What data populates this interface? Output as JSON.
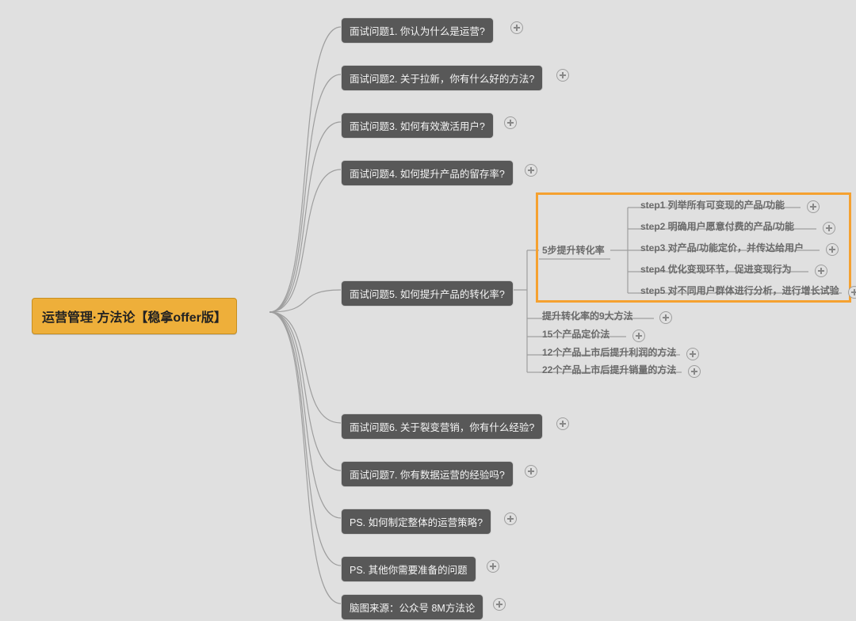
{
  "root": {
    "label": "运营管理·方法论【稳拿offer版】"
  },
  "branches": [
    {
      "id": "b1",
      "label": "面试问题1. 你认为什么是运营?"
    },
    {
      "id": "b2",
      "label": "面试问题2. 关于拉新，你有什么好的方法?"
    },
    {
      "id": "b3",
      "label": "面试问题3. 如何有效激活用户?"
    },
    {
      "id": "b4",
      "label": "面试问题4. 如何提升产品的留存率?"
    },
    {
      "id": "b5",
      "label": "面试问题5. 如何提升产品的转化率?"
    },
    {
      "id": "b6",
      "label": "面试问题6. 关于裂变营销，你有什么经验?"
    },
    {
      "id": "b7",
      "label": "面试问题7. 你有数据运营的经验吗?"
    },
    {
      "id": "b8",
      "label": "PS. 如何制定整体的运营策略?"
    },
    {
      "id": "b9",
      "label": "PS. 其他你需要准备的问题"
    },
    {
      "id": "b10",
      "label": "脑图来源：公众号 8M方法论"
    }
  ],
  "detail5": {
    "heading": "5步提升转化率",
    "steps": [
      "step1 列举所有可变现的产品/功能",
      "step2 明确用户愿意付费的产品/功能",
      "step3 对产品/功能定价，并传达给用户",
      "step4 优化变现环节，促进变现行为",
      "step5 对不同用户群体进行分析，进行增长试验"
    ],
    "siblings": [
      "提升转化率的9大方法",
      "15个产品定价法",
      "12个产品上市后提升利润的方法",
      "22个产品上市后提升销量的方法"
    ]
  }
}
